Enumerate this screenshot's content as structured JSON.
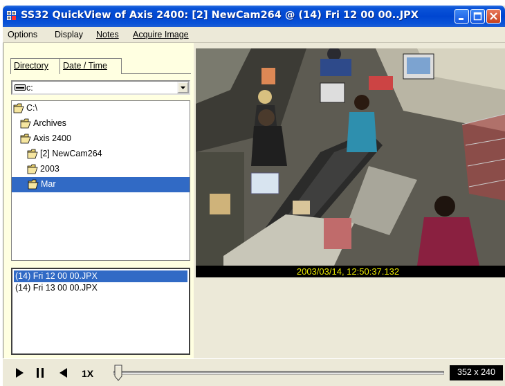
{
  "window": {
    "title": "SS32 QuickView of Axis 2400: [2] NewCam264 @ (14) Fri 12 00 00..JPX"
  },
  "menu": {
    "items": [
      "Options",
      "Display",
      "Notes",
      "Acquire Image"
    ]
  },
  "tabs": {
    "directory": "Directory",
    "date_time": "Date / Time"
  },
  "drive": {
    "selected": "c:"
  },
  "tree": {
    "items": [
      {
        "label": "C:\\",
        "selected": false
      },
      {
        "label": "Archives",
        "selected": false
      },
      {
        "label": "Axis 2400",
        "selected": false
      },
      {
        "label": "[2] NewCam264",
        "selected": false
      },
      {
        "label": "2003",
        "selected": false
      },
      {
        "label": "Mar",
        "selected": true
      }
    ]
  },
  "files": {
    "items": [
      {
        "label": "(14) Fri 12 00 00.JPX",
        "selected": true
      },
      {
        "label": "(14) Fri 13 00 00.JPX",
        "selected": false
      }
    ]
  },
  "video": {
    "timestamp": "2003/03/14, 12:50:37.132"
  },
  "playback": {
    "speed": "1X",
    "resolution": "352 x 240",
    "position": 0
  },
  "colors": {
    "title_bar": "#0046d1",
    "selection": "#316ac5",
    "pane_bg": "#ffffe1",
    "timestamp_text": "#e8e800"
  }
}
